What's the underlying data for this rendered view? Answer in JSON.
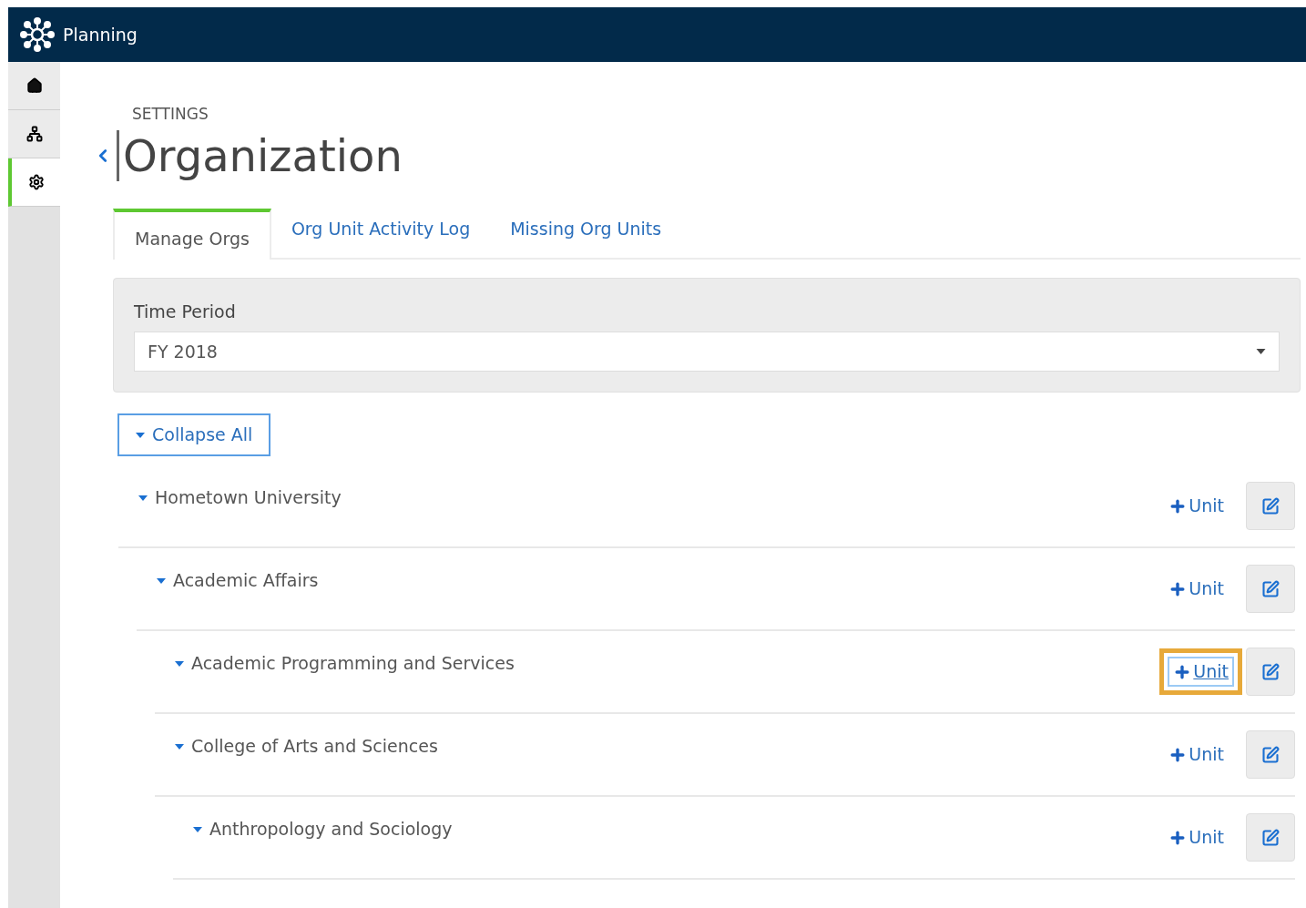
{
  "app": {
    "title": "Planning"
  },
  "sidebar": {
    "items": [
      {
        "kind": "home",
        "selected": false
      },
      {
        "kind": "sitemap",
        "selected": false
      },
      {
        "kind": "settings",
        "selected": true
      }
    ]
  },
  "page": {
    "section": "SETTINGS",
    "title": "Organization"
  },
  "tabs": [
    {
      "label": "Manage Orgs",
      "selected": true
    },
    {
      "label": "Org Unit Activity Log",
      "selected": false
    },
    {
      "label": "Missing Org Units",
      "selected": false
    }
  ],
  "filter": {
    "label": "Time Period",
    "value": "FY 2018"
  },
  "collapse_button": {
    "label": "Collapse All"
  },
  "tree": [
    {
      "label": "Hometown University",
      "expanded": true,
      "add_label": "Unit",
      "focused": false,
      "children": [
        {
          "label": "Academic Affairs",
          "expanded": true,
          "add_label": "Unit",
          "focused": false,
          "children": [
            {
              "label": "Academic Programming and Services",
              "expanded": true,
              "add_label": "Unit",
              "focused": true
            },
            {
              "label": "College of Arts and Sciences",
              "expanded": true,
              "add_label": "Unit",
              "focused": false,
              "children": [
                {
                  "label": "Anthropology and Sociology",
                  "expanded": true,
                  "add_label": "Unit",
                  "focused": false
                }
              ]
            }
          ]
        }
      ]
    }
  ]
}
